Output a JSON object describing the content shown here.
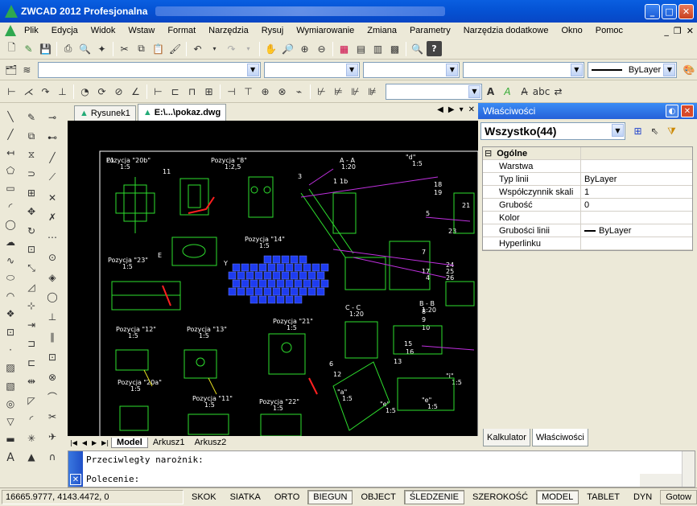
{
  "window": {
    "title": "ZWCAD 2012 Profesjonalna"
  },
  "menu": [
    "Plik",
    "Edycja",
    "Widok",
    "Wstaw",
    "Format",
    "Narzędzia",
    "Rysuj",
    "Wymiarowanie",
    "Zmiana",
    "Parametry",
    "Narzędzia dodatkowe",
    "Okno",
    "Pomoc"
  ],
  "toolbar": {
    "linetype_value": "ByLayer"
  },
  "tabs": [
    {
      "label": "Rysunek1"
    },
    {
      "label": "E:\\...\\pokaz.dwg"
    }
  ],
  "layouts": [
    "Model",
    "Arkusz1",
    "Arkusz2"
  ],
  "drawing_labels": [
    "Pozycja \"20b\"",
    "1:5",
    "Pozycja \"8\"",
    "1:2,5",
    "A - A",
    "1:20",
    "\"d\"",
    "1:5",
    "Pozycja \"14\"",
    "1:5",
    "Pozycja \"23\"",
    "1:5",
    "Pozycja \"12\"",
    "1:5",
    "Pozycja \"13\"",
    "1:5",
    "Pozycja \"21\"",
    "1:5",
    "Pozycja \"20a\"",
    "1:5",
    "Pozycja \"11\"",
    "1:5",
    "Pozycja \"22\"",
    "1:5",
    "C - C",
    "1:20",
    "B - B",
    "1:20",
    "\"a\"",
    "1:5",
    "E",
    "\"e\"",
    "1:5",
    "\"e\"",
    "1:5",
    "\"i\"",
    "1:5",
    "1",
    "1b",
    "3",
    "18",
    "19",
    "21",
    "23",
    "24",
    "25",
    "26",
    "4",
    "5",
    "6",
    "12",
    "13",
    "15",
    "16",
    "17",
    "7",
    "8",
    "9",
    "10",
    "11",
    "Y",
    "E1"
  ],
  "properties": {
    "panel_title": "Właściwości",
    "selection": "Wszystko(44)",
    "group": "Ogólne",
    "rows": [
      {
        "key": "Warstwa",
        "value": ""
      },
      {
        "key": "Typ linii",
        "value": "ByLayer"
      },
      {
        "key": "Współczynnik skali",
        "value": "1"
      },
      {
        "key": "Grubość",
        "value": "0"
      },
      {
        "key": "Kolor",
        "value": ""
      },
      {
        "key": "Grubości linii",
        "value": "ByLayer"
      },
      {
        "key": "Hyperlinku",
        "value": ""
      }
    ],
    "tabs": [
      "Kalkulator",
      "Właściwości"
    ]
  },
  "command": {
    "line1": "Przeciwległy narożnik:",
    "line2": "Polecenie:"
  },
  "status": {
    "coords": "16665.9777,  4143.4472,  0",
    "buttons": [
      {
        "label": "SKOK",
        "on": false
      },
      {
        "label": "SIATKA",
        "on": false
      },
      {
        "label": "ORTO",
        "on": false
      },
      {
        "label": "BIEGUN",
        "on": true
      },
      {
        "label": "OBJECT",
        "on": false
      },
      {
        "label": "ŚLEDZENIE",
        "on": true
      },
      {
        "label": "SZEROKOŚĆ",
        "on": false
      },
      {
        "label": "MODEL",
        "on": true
      },
      {
        "label": "TABLET",
        "on": false
      },
      {
        "label": "DYN",
        "on": false
      }
    ],
    "ready": "Gotow"
  }
}
